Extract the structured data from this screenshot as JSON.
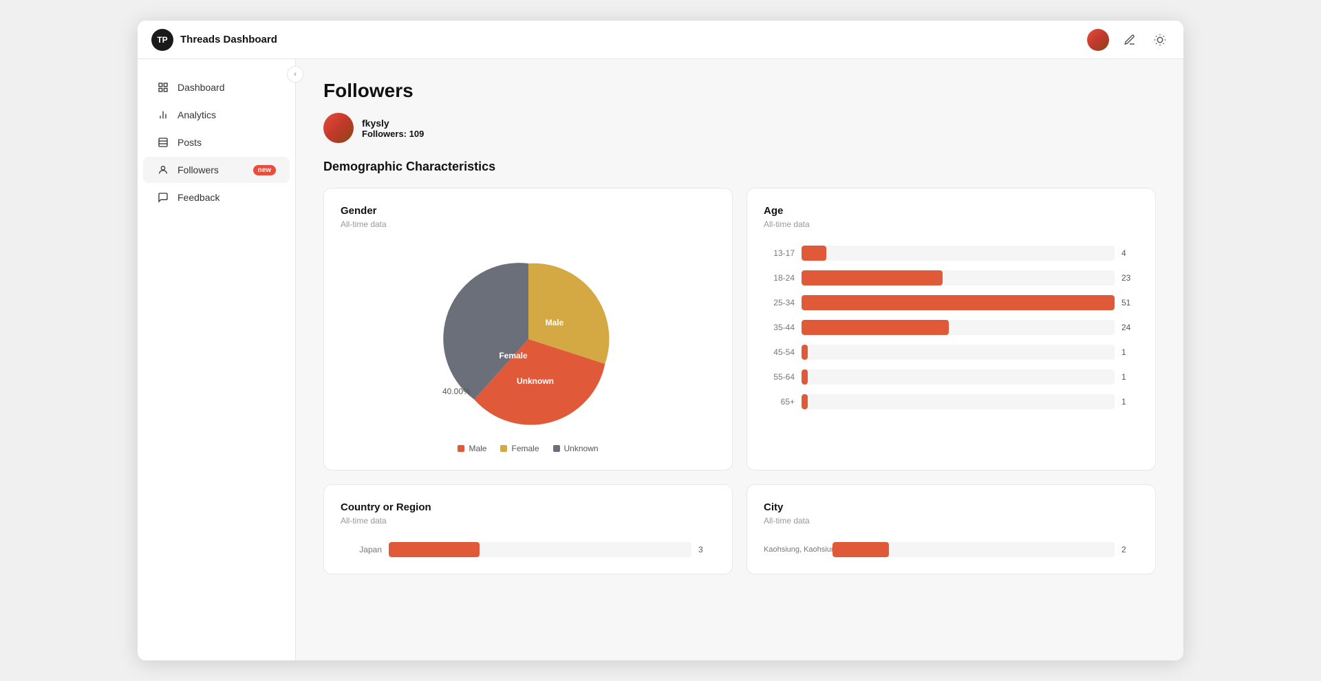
{
  "app": {
    "title": "Threads Dashboard",
    "logo_initials": "TP"
  },
  "topbar": {
    "translate_icon": "⇄",
    "settings_icon": "☀"
  },
  "sidebar": {
    "items": [
      {
        "id": "dashboard",
        "label": "Dashboard",
        "active": false
      },
      {
        "id": "analytics",
        "label": "Analytics",
        "active": false
      },
      {
        "id": "posts",
        "label": "Posts",
        "active": false
      },
      {
        "id": "followers",
        "label": "Followers",
        "active": true,
        "badge": "new"
      },
      {
        "id": "feedback",
        "label": "Feedback",
        "active": false
      }
    ]
  },
  "page": {
    "title": "Followers",
    "profile": {
      "username": "fkysly",
      "followers_label": "Followers:",
      "followers_count": "109"
    },
    "section": "Demographic Characteristics",
    "gender_card": {
      "title": "Gender",
      "subtitle": "All-time data",
      "segments": [
        {
          "label": "Male",
          "value": 32.38,
          "color": "#e05a3a"
        },
        {
          "label": "Female",
          "value": 40.0,
          "color": "#d4a843"
        },
        {
          "label": "Unknown",
          "value": 27.62,
          "color": "#6b6f7a"
        }
      ],
      "legend": [
        {
          "label": "Male",
          "color": "#e05a3a"
        },
        {
          "label": "Female",
          "color": "#d4a843"
        },
        {
          "label": "Unknown",
          "color": "#6b6f7a"
        }
      ]
    },
    "age_card": {
      "title": "Age",
      "subtitle": "All-time data",
      "bars": [
        {
          "label": "13-17",
          "value": 4,
          "max": 51
        },
        {
          "label": "18-24",
          "value": 23,
          "max": 51
        },
        {
          "label": "25-34",
          "value": 51,
          "max": 51
        },
        {
          "label": "35-44",
          "value": 24,
          "max": 51
        },
        {
          "label": "45-54",
          "value": 1,
          "max": 51
        },
        {
          "label": "55-64",
          "value": 1,
          "max": 51
        },
        {
          "label": "65+",
          "value": 1,
          "max": 51
        }
      ]
    },
    "country_card": {
      "title": "Country or Region",
      "subtitle": "All-time data",
      "bars": [
        {
          "label": "Japan",
          "value": 3,
          "max": 10
        }
      ]
    },
    "city_card": {
      "title": "City",
      "subtitle": "All-time data",
      "bars": [
        {
          "label": "Kaohsiung, Kaohsiung",
          "value": 2,
          "max": 10
        }
      ]
    }
  }
}
